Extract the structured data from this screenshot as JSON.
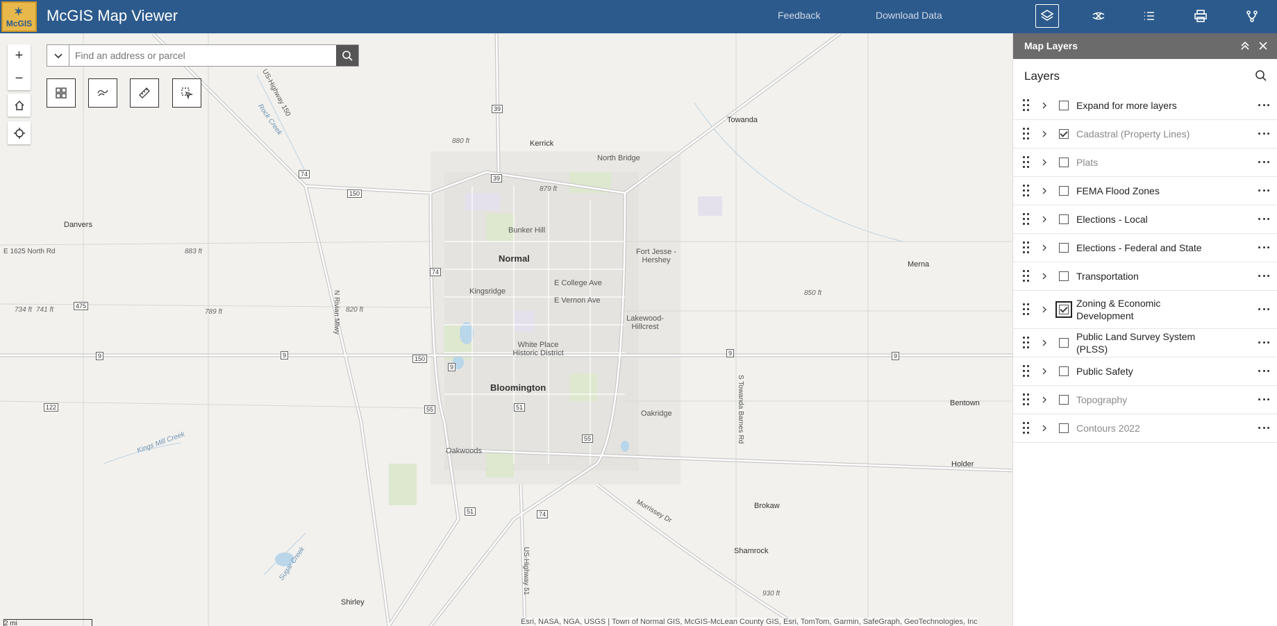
{
  "header": {
    "logo_text": "McGIS",
    "title": "McGIS Map Viewer",
    "links": [
      "Feedback",
      "Download Data"
    ],
    "buttons": [
      "layers-icon",
      "basemap-icon",
      "legend-icon",
      "print-icon",
      "share-icon"
    ],
    "bg_color": "#2c5a8c"
  },
  "search": {
    "placeholder": "Find an address or parcel",
    "value": ""
  },
  "map": {
    "places": [
      "Towanda",
      "Kerrick",
      "North Bridge",
      "Danvers",
      "Normal",
      "Bunker Hill",
      "Kingsridge",
      "Fort Jesse - Hershey",
      "E College Ave",
      "E Vernon Ave",
      "Lakewood-Hillcrest",
      "White Place Historic District",
      "Bloomington",
      "Oakridge",
      "Oakwoods",
      "Merna",
      "Bentown",
      "Holder",
      "Brokaw",
      "Shamrock",
      "Shirley",
      "E 1625 North Rd",
      "N Rivian Mtwy",
      "S Towanda Barnes Rd",
      "US-Highway 150",
      "Rock Creek",
      "Kings Mill Creek",
      "Sugar Creek",
      "Morrissey Dr",
      "US-Highway 51"
    ],
    "elevations": [
      "880 ft",
      "879 ft",
      "883 ft",
      "789 ft",
      "820 ft",
      "734 ft",
      "741 ft",
      "850 ft",
      "930 ft"
    ],
    "shields": [
      "39",
      "39",
      "74",
      "150",
      "475",
      "9",
      "9",
      "150",
      "9",
      "9",
      "9",
      "122",
      "74",
      "55",
      "51",
      "55",
      "51",
      "74"
    ],
    "scale_label": "2 mi",
    "attribution": "Esri, NASA, NGA, USGS | Town of Normal GIS, McGIS-McLean County GIS, Esri, TomTom, Garmin, SafeGraph, GeoTechnologies, Inc"
  },
  "panel": {
    "header_title": "Map Layers",
    "title": "Layers",
    "layers": [
      {
        "label": "Expand for more layers",
        "checked": false,
        "muted": false
      },
      {
        "label": "Cadastral (Property Lines)",
        "checked": true,
        "muted": true
      },
      {
        "label": "Plats",
        "checked": false,
        "muted": true
      },
      {
        "label": "FEMA Flood Zones",
        "checked": false,
        "muted": false
      },
      {
        "label": "Elections - Local",
        "checked": false,
        "muted": false
      },
      {
        "label": "Elections - Federal and State",
        "checked": false,
        "muted": false
      },
      {
        "label": "Transportation",
        "checked": false,
        "muted": false
      },
      {
        "label": "Zoning & Economic Development",
        "checked": true,
        "muted": false
      },
      {
        "label": "Public Land Survey System (PLSS)",
        "checked": false,
        "muted": false
      },
      {
        "label": "Public Safety",
        "checked": false,
        "muted": false
      },
      {
        "label": "Topography",
        "checked": false,
        "muted": true
      },
      {
        "label": "Contours 2022",
        "checked": false,
        "muted": true
      }
    ]
  }
}
